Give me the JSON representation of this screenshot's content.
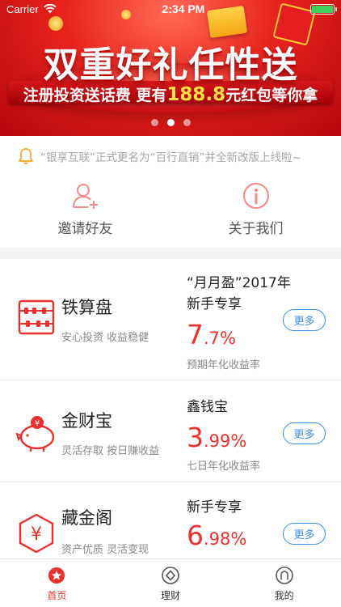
{
  "status_bar": {
    "carrier": "Carrier",
    "time": "2:34 PM",
    "battery_level": 1.0
  },
  "banner": {
    "title": "双重好礼任性送",
    "subtitle_prefix": "注册投资送话费  更有",
    "subtitle_amount": "188.8",
    "subtitle_suffix": "元红包等你拿",
    "slides": 3,
    "active_slide": 2
  },
  "notice": {
    "icon": "bell-icon",
    "text": "“银享互联”正式更名为“百行直销”并全新改版上线啦~"
  },
  "quick_links": [
    {
      "label": "邀请好友",
      "icon": "invite-friend-icon"
    },
    {
      "label": "关于我们",
      "icon": "info-icon"
    }
  ],
  "products": [
    {
      "name": "铁算盘",
      "tags": "安心投资  收益稳健",
      "icon": "abacus-icon",
      "title": "“月月盈”2017年新手专享",
      "rate_int": "7",
      "rate_dec": ".7%",
      "rate_label": "预期年化收益率",
      "more": "更多"
    },
    {
      "name": "金财宝",
      "tags": "灵活存取  按日赚收益",
      "icon": "piggy-bank-icon",
      "title": "鑫钱宝",
      "rate_int": "3",
      "rate_dec": ".99%",
      "rate_label": "七日年化收益率",
      "more": "更多"
    },
    {
      "name": "藏金阁",
      "tags": "资产优质  灵活变现",
      "icon": "yuan-hexagon-icon",
      "title": "新手专享",
      "rate_int": "6",
      "rate_dec": ".98%",
      "rate_label": "",
      "more": "更多"
    }
  ],
  "tabs": [
    {
      "label": "首页",
      "icon": "home-star-icon",
      "active": true
    },
    {
      "label": "理财",
      "icon": "finance-diamond-icon",
      "active": false
    },
    {
      "label": "我的",
      "icon": "profile-icon",
      "active": false
    }
  ],
  "colors": {
    "accent_red": "#e8312f",
    "link_blue": "#3a8ee6",
    "notice_orange": "#f5a623"
  }
}
